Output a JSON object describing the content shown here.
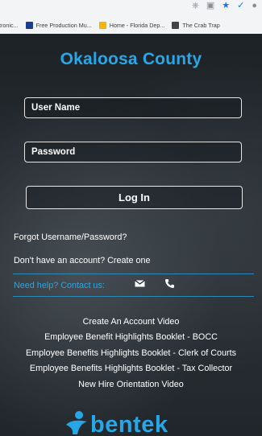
{
  "browser": {
    "bookmarks": [
      {
        "label": "tronic...",
        "icon": "none",
        "color": "#f3f4f6"
      },
      {
        "label": "Free Production Mu...",
        "icon": "production-music-icon",
        "color": "#1b3c8f"
      },
      {
        "label": "Home - Florida Dep...",
        "icon": "florida-dept-icon",
        "color": "#f4b400"
      },
      {
        "label": "The Crab Trap",
        "icon": "crab-trap-icon",
        "color": "#444444"
      }
    ]
  },
  "header": {
    "title": "Okaloosa County"
  },
  "login": {
    "username_placeholder": "User Name",
    "password_placeholder": "Password",
    "login_label": "Log In"
  },
  "links": {
    "forgot": "Forgot Username/Password?",
    "create": "Don't have an account? Create one"
  },
  "help": {
    "label": "Need help? Contact us:",
    "icons": [
      "envelope-icon",
      "phone-icon"
    ]
  },
  "resources": [
    "Create An Account Video",
    "Employee Benefit Highlights Booklet - BOCC",
    "Employee Benefits Highlights Booklet - Clerk of Courts",
    "Employee Benefits Highlights Booklet - Tax Collector",
    "New Hire Orientation Video"
  ],
  "footer": {
    "logo_text": "bentek"
  },
  "colors": {
    "accent": "#27a7e7",
    "background": "#1e2327",
    "text": "#ffffff"
  }
}
